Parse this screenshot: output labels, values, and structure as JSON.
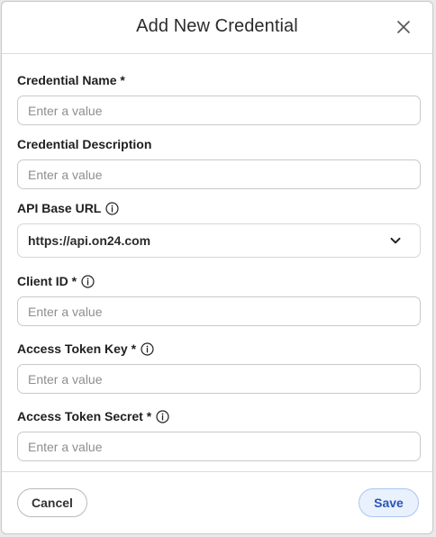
{
  "dialog": {
    "title": "Add New Credential"
  },
  "fields": {
    "credential_name": {
      "label": "Credential Name *",
      "placeholder": "Enter a value",
      "value": ""
    },
    "credential_description": {
      "label": "Credential Description",
      "placeholder": "Enter a value",
      "value": ""
    },
    "api_base_url": {
      "label": "API Base URL",
      "selected": "https://api.on24.com"
    },
    "client_id": {
      "label": "Client ID *",
      "placeholder": "Enter a value",
      "value": ""
    },
    "access_token_key": {
      "label": "Access Token Key *",
      "placeholder": "Enter a value",
      "value": ""
    },
    "access_token_secret": {
      "label": "Access Token Secret *",
      "placeholder": "Enter a value",
      "value": ""
    }
  },
  "footer": {
    "cancel_label": "Cancel",
    "save_label": "Save"
  },
  "icons": {
    "close": "close-icon",
    "info": "info-icon",
    "dropdown": "chevron-down-icon"
  },
  "colors": {
    "save_text": "#2a56b6",
    "save_bg": "#e9f1fd",
    "save_border": "#a9c6ef"
  }
}
